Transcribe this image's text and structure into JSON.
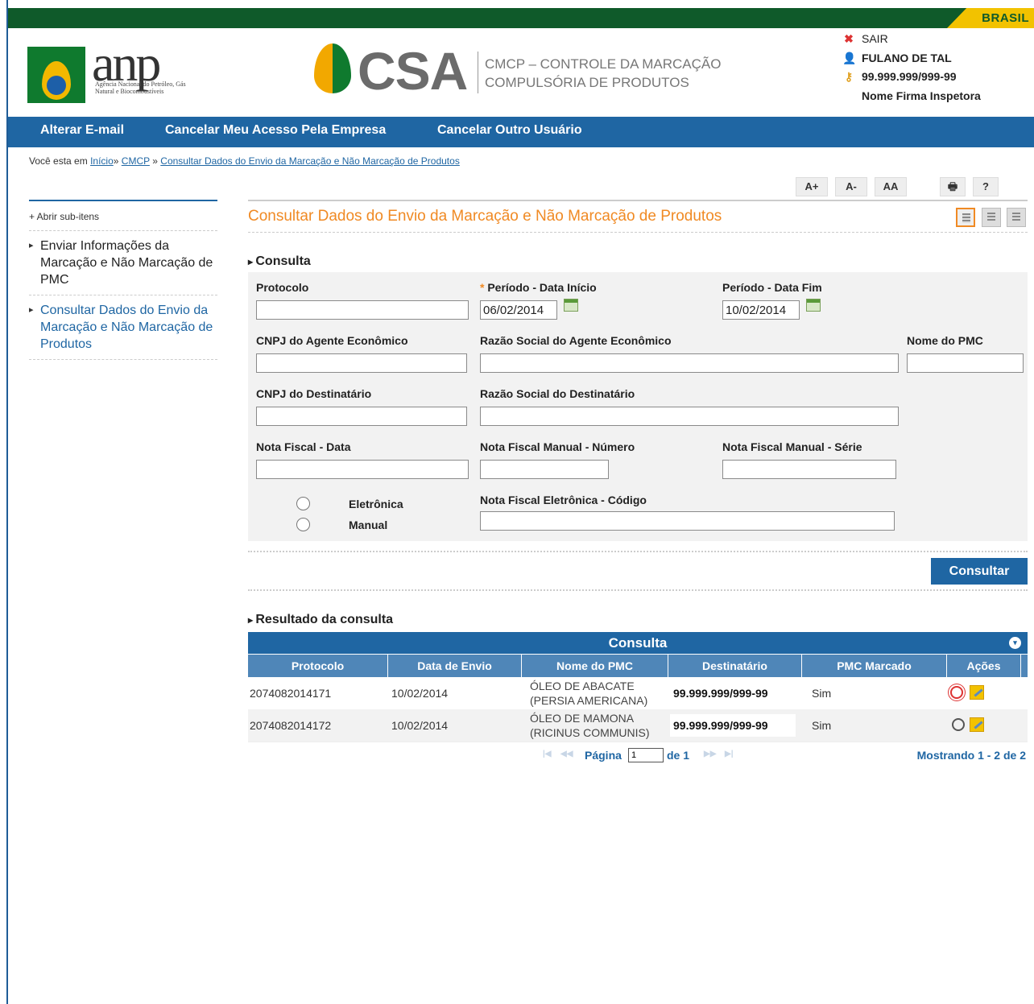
{
  "top_bar": {
    "brand": "BRASIL"
  },
  "header": {
    "anp_logo_text": "anp",
    "anp_logo_sub": "Agência Nacional do Petróleo, Gás Natural e Biocombustíveis",
    "csa_logo_text": "CSA",
    "csa_subtitle_line1": "CMCP – CONTROLE DA MARCAÇÃO",
    "csa_subtitle_line2": "COMPULSÓRIA DE PRODUTOS"
  },
  "user": {
    "logout": "SAIR",
    "name": "FULANO DE TAL",
    "cnpj": "99.999.999/999-99",
    "firm": "Nome Firma Inspetora"
  },
  "nav": {
    "items": [
      "Alterar E-mail",
      "Cancelar Meu Acesso Pela Empresa",
      "Cancelar Outro Usuário"
    ]
  },
  "breadcrumb": {
    "prefix": "Você esta em",
    "links": [
      "Início",
      "CMCP",
      "Consultar Dados do Envio da Marcação e Não Marcação de Produtos"
    ],
    "separator": "»"
  },
  "tools": {
    "font_increase": "A+",
    "font_decrease": "A-",
    "font_reset": "AA",
    "print": "🖶",
    "help": "?"
  },
  "sidebar": {
    "toggle": "+ Abrir sub-itens",
    "items": [
      "Enviar Informações da Marcação e Não Marcação de PMC",
      "Consultar Dados do Envio da Marcação e Não Marcação de Produtos"
    ]
  },
  "page": {
    "title": "Consultar Dados do Envio da Marcação e Não Marcação de Produtos",
    "section_consulta": "Consulta",
    "section_resultado": "Resultado da consulta"
  },
  "form": {
    "protocolo_label": "Protocolo",
    "protocolo_value": "",
    "data_inicio_required": "*",
    "data_inicio_label": "Período - Data Início",
    "data_inicio_value": "06/02/2014",
    "data_fim_label": "Período - Data Fim",
    "data_fim_value": "10/02/2014",
    "cnpj_agente_label": "CNPJ do Agente Econômico",
    "razao_agente_label": "Razão Social do Agente Econômico",
    "nome_pmc_label": "Nome do PMC",
    "cnpj_dest_label": "CNPJ do Destinatário",
    "razao_dest_label": "Razão Social do Destinatário",
    "nf_data_label": "Nota Fiscal - Data",
    "nf_manual_num_label": "Nota Fiscal Manual - Número",
    "nf_manual_serie_label": "Nota Fiscal Manual - Série",
    "radio_eletronica": "Eletrônica",
    "radio_manual": "Manual",
    "nf_eletronica_label": "Nota Fiscal Eletrônica - Código",
    "submit": "Consultar"
  },
  "grid": {
    "caption": "Consulta",
    "toggle_icon": "▾",
    "columns": [
      "Protocolo",
      "Data de Envio",
      "Nome do PMC",
      "Destinatário",
      "PMC Marcado",
      "Ações"
    ],
    "rows": [
      {
        "protocolo": "2074082014171",
        "data": "10/02/2014",
        "pmc_line1": "ÓLEO DE ABACATE",
        "pmc_line2": "(PERSIA AMERICANA)",
        "destinatario": "99.999.999/999-99",
        "marcado": "Sim"
      },
      {
        "protocolo": "2074082014172",
        "data": "10/02/2014",
        "pmc_line1": "ÓLEO DE MAMONA",
        "pmc_line2": "(RICINUS COMMUNIS)",
        "destinatario": "99.999.999/999-99",
        "marcado": "Sim"
      }
    ],
    "pager": {
      "page_label": "Página",
      "page_value": "1",
      "of_label": "de 1",
      "showing": "Mostrando 1 - 2 de 2"
    }
  },
  "colors": {
    "brand_blue": "#1f66a3",
    "accent_orange": "#f08a24",
    "gov_green": "#0f5a2a",
    "gov_yellow": "#f2c200"
  }
}
